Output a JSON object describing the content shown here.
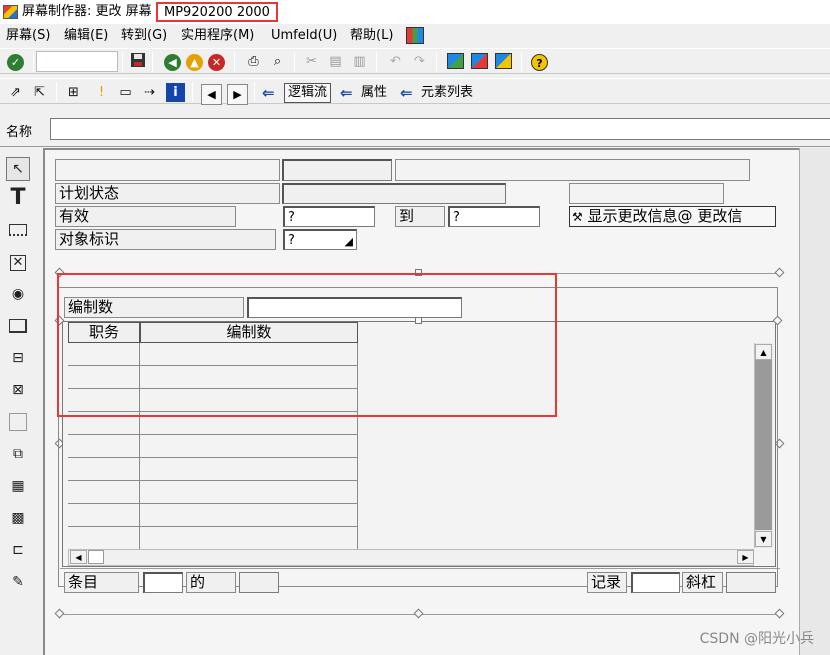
{
  "window": {
    "title_prefix": "屏幕制作器:  更改 屏幕",
    "screen_id": "MP920200 2000"
  },
  "menu": [
    {
      "label": "屏幕(S)"
    },
    {
      "label": "编辑(E)"
    },
    {
      "label": "转到(G)"
    },
    {
      "label": "实用程序(M)"
    },
    {
      "label": "Umfeld(U)"
    },
    {
      "label": "帮助(L)"
    }
  ],
  "toolbar2": {
    "flow_logic": "逻辑流",
    "attributes": "属性",
    "element_list": "元素列表"
  },
  "name_bar": {
    "label": "名称",
    "value": ""
  },
  "screen": {
    "plan_status_label": "计划状态",
    "valid_label": "有效",
    "valid_from": "?",
    "to_label": "到",
    "valid_to": "?",
    "object_id_label": "对象标识",
    "object_id": "?",
    "show_change_info": "显示更改信息@ 更改信",
    "headcount_label": "编制数",
    "headcount_value": "",
    "table": {
      "headers": [
        "职务",
        "编制数"
      ],
      "row_count": 9
    },
    "footer": {
      "entries_label": "条目",
      "of_label": "的",
      "record_label": "记录",
      "slash_label": "斜杠"
    }
  },
  "watermark": "CSDN @阳光小兵",
  "colors": {
    "highlight": "#e53935",
    "accent_arrow": "#1346a8"
  }
}
